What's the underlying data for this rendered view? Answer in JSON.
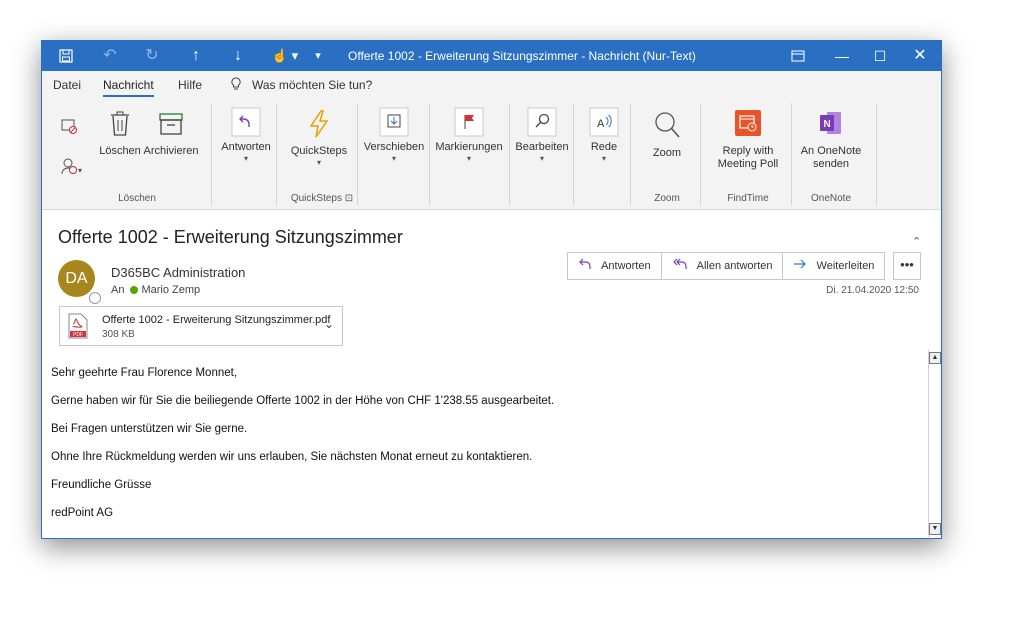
{
  "window": {
    "title": "Offerte 1002 - Erweiterung Sitzungszimmer  -  Nachricht (Nur-Text)"
  },
  "menu": {
    "items": [
      "Datei",
      "Nachricht",
      "Hilfe"
    ],
    "search": "Was möchten Sie tun?"
  },
  "ribbon": {
    "loeschen": "Löschen",
    "archivieren": "Archivieren",
    "group_loeschen": "Löschen",
    "antworten": "Antworten",
    "quicksteps": "QuickSteps",
    "group_quicksteps": "QuickSteps",
    "verschieben": "Verschieben",
    "markierungen": "Markierungen",
    "bearbeiten": "Bearbeiten",
    "rede": "Rede",
    "zoom": "Zoom",
    "group_zoom": "Zoom",
    "reply_poll_1": "Reply with",
    "reply_poll_2": "Meeting Poll",
    "group_findtime": "FindTime",
    "onenote_1": "An OneNote",
    "onenote_2": "senden",
    "group_onenote": "OneNote"
  },
  "message": {
    "subject": "Offerte 1002 - Erweiterung Sitzungszimmer",
    "avatar_initials": "DA",
    "sender": "D365BC Administration",
    "to_label": "An",
    "to_name": "Mario Zemp",
    "date": "Di. 21.04.2020 12:50",
    "actions": {
      "reply": "Antworten",
      "reply_all": "Allen antworten",
      "forward": "Weiterleiten",
      "more": "•••"
    },
    "attachment": {
      "name": "Offerte 1002 - Erweiterung Sitzungszimmer.pdf",
      "size": "308 KB",
      "icon_text": "PDF"
    },
    "body": [
      "Sehr geehrte Frau Florence Monnet,",
      "Gerne haben wir für Sie die beiliegende Offerte 1002 in der Höhe von CHF 1'238.55 ausgearbeitet.",
      "Bei Fragen unterstützen wir Sie gerne.",
      "Ohne Ihre Rückmeldung werden wir uns erlauben, Sie nächsten Monat erneut zu kontaktieren.",
      "Freundliche Grüsse",
      "redPoint AG"
    ]
  },
  "colors": {
    "accent": "#2b6fc2",
    "avatar": "#a8861e",
    "findtime": "#e8532a",
    "onenote": "#7a3bb8",
    "presence": "#57a300"
  }
}
